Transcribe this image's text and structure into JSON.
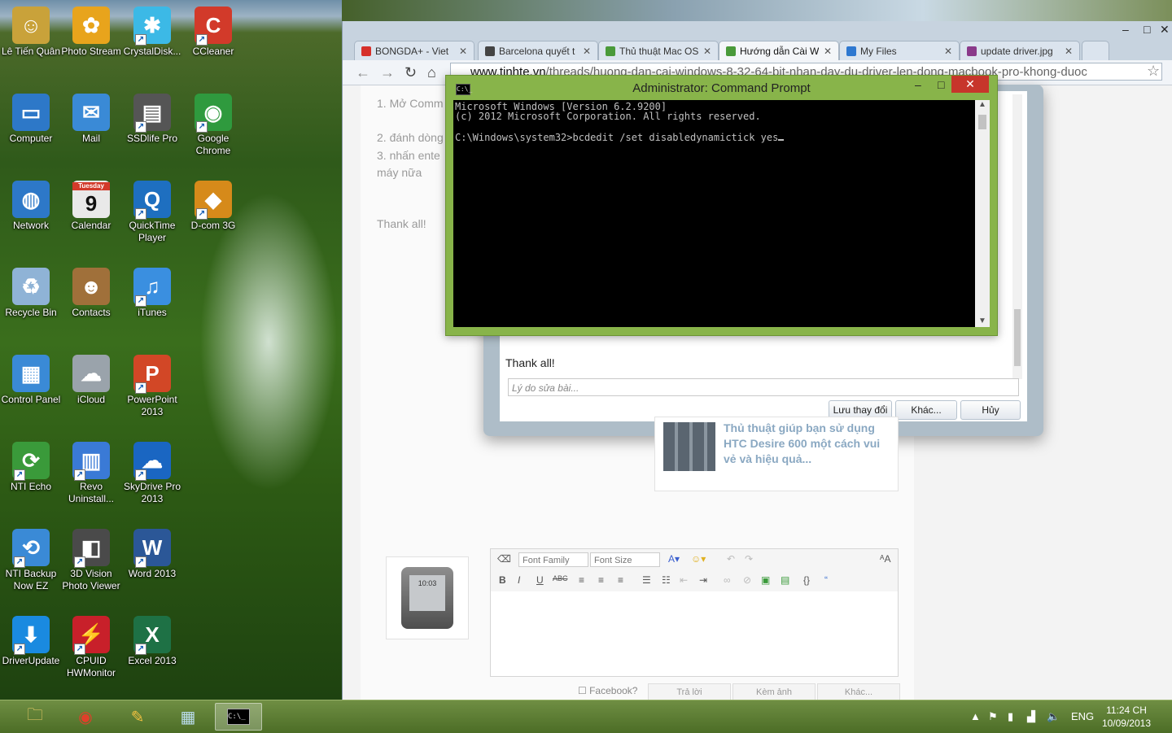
{
  "desktop": {
    "icons": [
      {
        "label": "Lê Tiến Quân",
        "icon": "user-folder-icon",
        "color": "#c9a23a"
      },
      {
        "label": "Photo Stream",
        "icon": "photo-stream-icon",
        "color": "#e8a41c"
      },
      {
        "label": "CrystalDisk...",
        "icon": "crystaldisk-icon",
        "color": "#3cb9e6"
      },
      {
        "label": "CCleaner",
        "icon": "ccleaner-icon",
        "color": "#d23a2a"
      },
      {
        "label": "Computer",
        "icon": "computer-icon",
        "color": "#2d78c8"
      },
      {
        "label": "Mail",
        "icon": "mail-icon",
        "color": "#3a8ad6"
      },
      {
        "label": "SSDlife Pro",
        "icon": "ssdlife-icon",
        "color": "#555555"
      },
      {
        "label": "Google Chrome",
        "icon": "chrome-icon",
        "color": "#2f9a3e"
      },
      {
        "label": "Network",
        "icon": "network-icon",
        "color": "#2d78c8"
      },
      {
        "label": "Calendar",
        "icon": "calendar-icon",
        "color": "#e9e9e9"
      },
      {
        "label": "QuickTime Player",
        "icon": "quicktime-icon",
        "color": "#1e6fc0"
      },
      {
        "label": "D-com 3G",
        "icon": "dcom-icon",
        "color": "#d68a1a"
      },
      {
        "label": "Recycle Bin",
        "icon": "recycle-bin-icon",
        "color": "#8fb3d6"
      },
      {
        "label": "Contacts",
        "icon": "contacts-icon",
        "color": "#a0703a"
      },
      {
        "label": "iTunes",
        "icon": "itunes-icon",
        "color": "#3a8fe0"
      },
      {
        "label": "Control Panel",
        "icon": "control-panel-icon",
        "color": "#3a8ad6"
      },
      {
        "label": "iCloud",
        "icon": "icloud-icon",
        "color": "#9aa3ab"
      },
      {
        "label": "PowerPoint 2013",
        "icon": "powerpoint-icon",
        "color": "#d24726"
      },
      {
        "label": "NTI Echo",
        "icon": "nti-echo-icon",
        "color": "#3a9a3a"
      },
      {
        "label": "Revo Uninstall...",
        "icon": "revo-icon",
        "color": "#3a7ad6"
      },
      {
        "label": "SkyDrive Pro 2013",
        "icon": "skydrive-icon",
        "color": "#1a66c2"
      },
      {
        "label": "NTI Backup Now EZ",
        "icon": "nti-backup-icon",
        "color": "#3a8ad6"
      },
      {
        "label": "3D Vision Photo Viewer",
        "icon": "3d-vision-icon",
        "color": "#4a4a4a"
      },
      {
        "label": "Word 2013",
        "icon": "word-icon",
        "color": "#2b5797"
      },
      {
        "label": "DriverUpdate",
        "icon": "driverupdate-icon",
        "color": "#1a8ae0"
      },
      {
        "label": "CPUID HWMonitor",
        "icon": "hwmonitor-icon",
        "color": "#c8202a"
      },
      {
        "label": "Excel 2013",
        "icon": "excel-icon",
        "color": "#1e7145"
      }
    ],
    "calendar_day": "Tuesday",
    "calendar_date": "9"
  },
  "browser": {
    "tabs": [
      {
        "label": "BONGDA+ - Viet",
        "color": "#d6302a"
      },
      {
        "label": "Barcelona quyết t",
        "color": "#444444"
      },
      {
        "label": "Thủ thuật Mac OS",
        "color": "#4a9a3a"
      },
      {
        "label": "Hướng dẫn Cài W",
        "color": "#4a9a3a"
      },
      {
        "label": "My Files",
        "color": "#2e78d0"
      },
      {
        "label": "update driver.jpg",
        "color": "#8a3a8a"
      }
    ],
    "url_domain": "www.tinhte.vn",
    "url_path": "/threads/huong-dan-cai-windows-8-32-64-bit-nhan-day-du-driver-len-dong-macbook-pro-khong-duoc",
    "page": {
      "bg_lines": [
        "1. Mở Comm",
        "2. đánh dòng",
        "3. nhấn ente",
        "máy nữa",
        "Thank all!"
      ],
      "dialog_text": "Thank all!",
      "reason_placeholder": "Lý do sửa bài...",
      "btn_save": "Lưu thay đổi",
      "btn_more": "Khác...",
      "btn_cancel": "Hủy",
      "related_title": "Thủ thuật giúp bạn sử dụng HTC Desire 600 một cách vui vẻ và hiệu quả...",
      "font_family": "Font Family",
      "font_size": "Font Size",
      "phone_time": "10:03",
      "facebook": "Facebook?",
      "reply": "Trả lời",
      "attach": "Kèm ảnh",
      "more": "Khác..."
    }
  },
  "cmd": {
    "title": "Administrator: Command Prompt",
    "icon_text": "C:\\_",
    "lines": [
      "Microsoft Windows [Version 6.2.9200]",
      "(c) 2012 Microsoft Corporation. All rights reserved.",
      "",
      "C:\\Windows\\system32>bcdedit /set disabledynamictick yes"
    ]
  },
  "taskbar": {
    "lang": "ENG",
    "time": "11:24 CH",
    "date": "10/09/2013"
  }
}
